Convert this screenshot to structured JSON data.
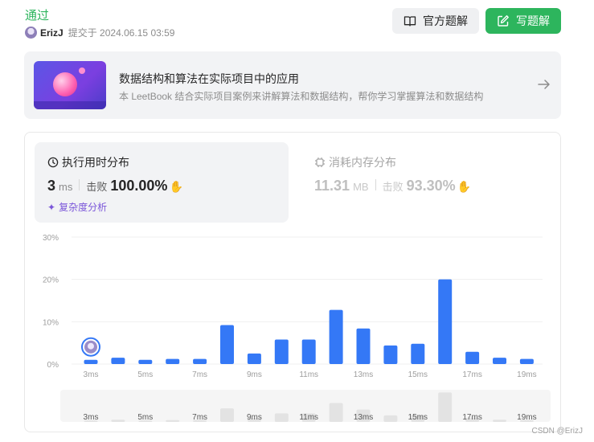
{
  "header": {
    "status": "通过",
    "user": "ErizJ",
    "submitted_prefix": "提交于",
    "submitted_time": "2024.06.15 03:59",
    "official_solution_label": "官方题解",
    "write_solution_label": "写题解"
  },
  "banner": {
    "title": "数据结构和算法在实际项目中的应用",
    "description": "本 LeetBook 结合实际项目案例来讲解算法和数据结构，帮你学习掌握算法和数据结构"
  },
  "runtime": {
    "title": "执行用时分布",
    "value": "3",
    "unit": "ms",
    "beat_label": "击败",
    "beat_pct": "100.00%",
    "complexity_label": "复杂度分析"
  },
  "memory": {
    "title": "消耗内存分布",
    "value": "11.31",
    "unit": "MB",
    "beat_label": "击败",
    "beat_pct": "93.30%"
  },
  "colors": {
    "accent_green": "#2db55d",
    "bar_blue": "#3478f6",
    "minimap_bar": "#e3e3e3"
  },
  "chart_data": {
    "type": "bar",
    "x": [
      3,
      4,
      5,
      6,
      7,
      8,
      9,
      10,
      11,
      12,
      13,
      14,
      15,
      16,
      17,
      18,
      19
    ],
    "values": [
      1.0,
      1.5,
      1.0,
      1.2,
      1.2,
      9.2,
      2.5,
      5.8,
      5.8,
      12.8,
      8.4,
      4.4,
      4.8,
      20.0,
      2.9,
      1.5,
      1.2
    ],
    "tick_labels": [
      "3ms",
      "5ms",
      "7ms",
      "9ms",
      "11ms",
      "13ms",
      "15ms",
      "17ms",
      "19ms"
    ],
    "y_ticks": [
      "30%",
      "20%",
      "10%",
      "0%"
    ],
    "ylim": [
      0,
      30
    ],
    "grid": true,
    "highlight_x": 3
  },
  "watermark": "CSDN @ErizJ"
}
